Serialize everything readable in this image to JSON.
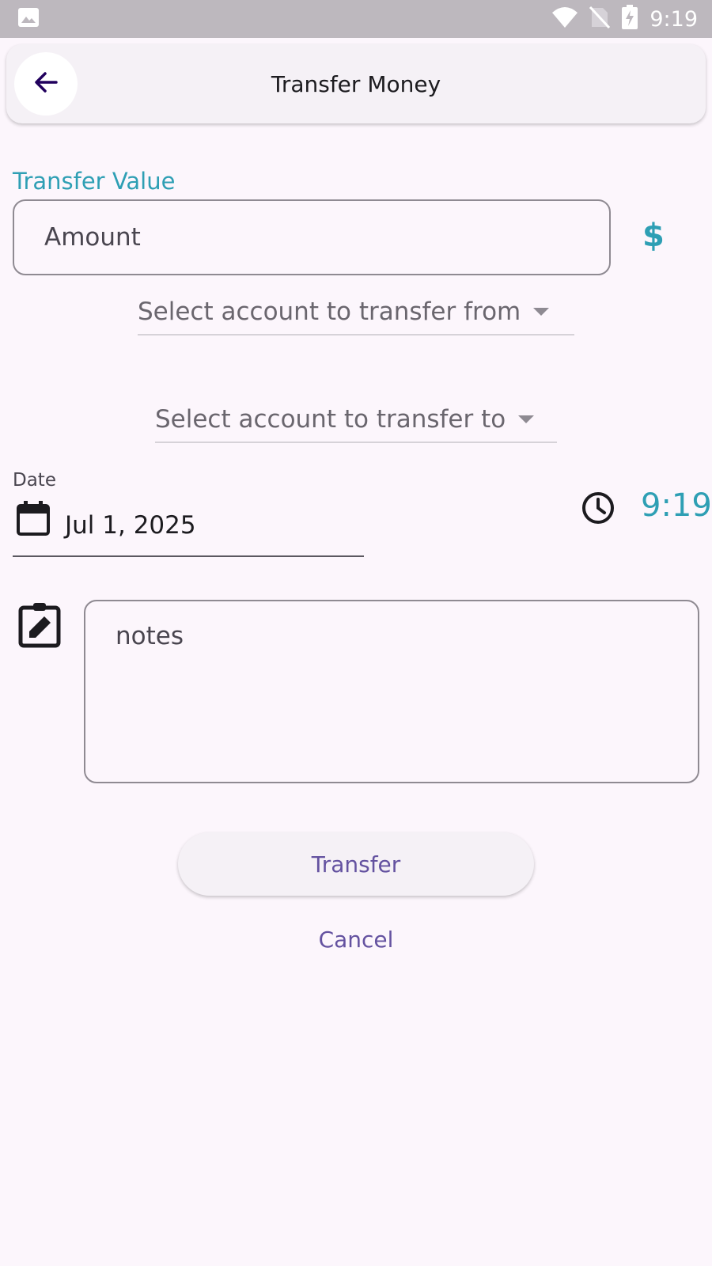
{
  "status_bar": {
    "time": "9:19",
    "icons": [
      "image-icon",
      "wifi-icon",
      "no-sim-icon",
      "battery-charging-icon"
    ]
  },
  "app_bar": {
    "title": "Transfer Money",
    "back_icon": "arrow-back-icon"
  },
  "form": {
    "section_label": "Transfer Value",
    "amount_placeholder": "Amount",
    "currency_symbol": "$",
    "from_account_placeholder": "Select account to transfer from",
    "to_account_placeholder": "Select account to transfer to",
    "date_label": "Date",
    "date_value": "Jul 1, 2025",
    "time_value": "9:19",
    "notes_placeholder": "notes"
  },
  "actions": {
    "transfer_label": "Transfer",
    "cancel_label": "Cancel"
  },
  "colors": {
    "accent": "#2e9fb4",
    "button_text": "#6452a0",
    "background": "#fcf6fc",
    "status_bar": "#bdb8be"
  }
}
